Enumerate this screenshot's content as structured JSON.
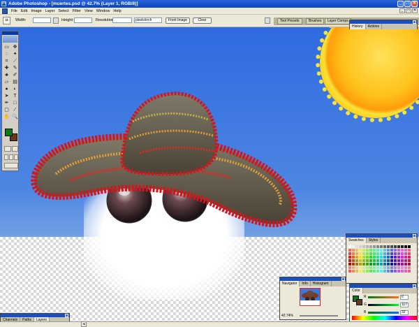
{
  "window": {
    "title": "Adobe Photoshop - [muertes.psd @ 42.7% (Layer 1, RGB/8)]",
    "min": "_",
    "max": "□",
    "close": "✕"
  },
  "menu": [
    "File",
    "Edit",
    "Image",
    "Layer",
    "Select",
    "Filter",
    "View",
    "Window",
    "Help"
  ],
  "options": {
    "width_label": "Width:",
    "height_label": "Height:",
    "resolution_label": "Resolution:",
    "resolution_unit": "pixels/inch",
    "front_image": "Front Image",
    "clear": "Clear"
  },
  "palette_well": [
    "Tool Presets",
    "Brushes",
    "Layer Comps"
  ],
  "panels": {
    "history": {
      "tabs": [
        "History",
        "Actions"
      ]
    },
    "swatches": {
      "tabs": [
        "Swatches",
        "Styles"
      ]
    },
    "navigator": {
      "tabs": [
        "Navigator",
        "Info",
        "Histogram"
      ],
      "zoom": "42.74%"
    },
    "color": {
      "tabs": [
        "Color"
      ],
      "r": "0",
      "g": "117",
      "b": "32"
    },
    "layers": {
      "tabs": [
        "Channels",
        "Paths",
        "Layers"
      ]
    }
  },
  "colors": {
    "foreground": "#0d7a18",
    "background": "#6a3a14",
    "titlebar": "#0a44c0",
    "ui_bg": "#ece9d8"
  }
}
